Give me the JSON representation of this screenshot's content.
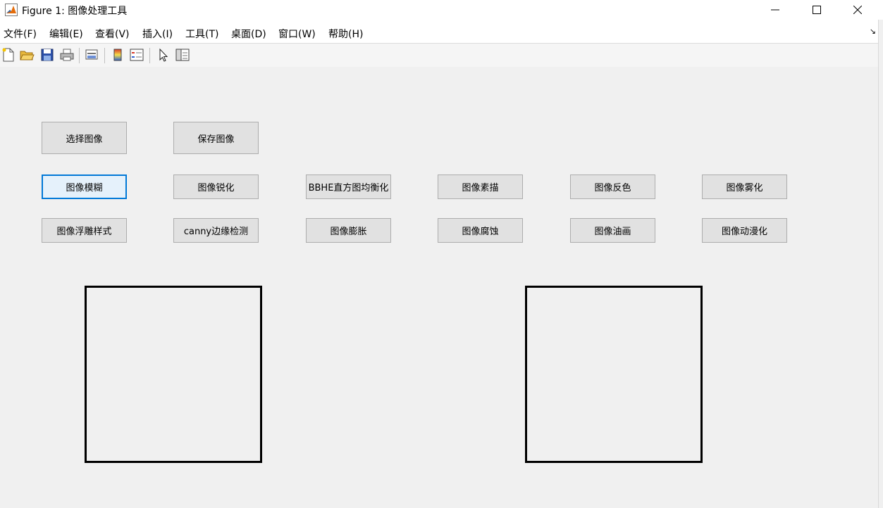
{
  "window": {
    "title": "Figure 1: 图像处理工具",
    "icon": "matlab-logo-icon",
    "controls": [
      "minimize-icon",
      "maximize-icon",
      "close-icon"
    ]
  },
  "menubar": {
    "items": [
      "文件(F)",
      "编辑(E)",
      "查看(V)",
      "插入(I)",
      "工具(T)",
      "桌面(D)",
      "窗口(W)",
      "帮助(H)"
    ]
  },
  "toolbar": {
    "buttons": [
      "new-figure-icon",
      "open-file-icon",
      "save-icon",
      "print-icon",
      "link-plot-icon",
      "colorbar-icon",
      "legend-icon",
      "edit-plot-arrow-icon",
      "property-inspector-icon"
    ]
  },
  "buttons": {
    "select_image": "选择图像",
    "save_image": "保存图像",
    "blur": "图像模糊",
    "sharpen": "图像锐化",
    "bbhe": "BBHE直方图均衡化",
    "sketch": "图像素描",
    "invert": "图像反色",
    "fog": "图像雾化",
    "emboss": "图像浮雕样式",
    "canny": "canny边缘检测",
    "dilate": "图像膨胀",
    "erode": "图像腐蚀",
    "oil": "图像油画",
    "anime": "图像动漫化"
  },
  "focused_button": "blur",
  "axes": [
    "left-image-axes",
    "right-image-axes"
  ]
}
